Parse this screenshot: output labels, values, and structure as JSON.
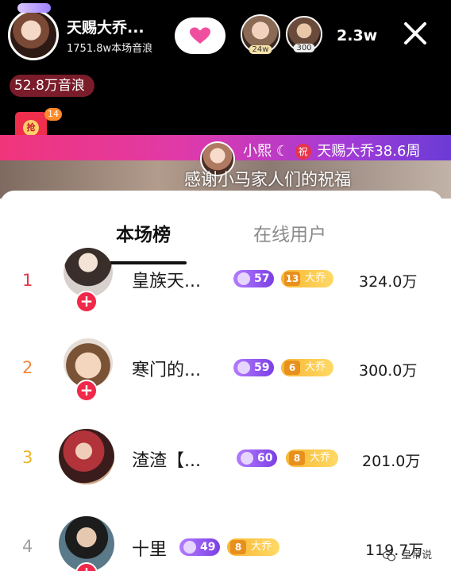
{
  "header": {
    "anchor_name": "天赐大乔...",
    "anchor_stats": "1751.8w本场音浪",
    "viewer_1_tag": "24w",
    "viewer_2_tag": "300",
    "viewer_count": "2.3w",
    "sound_wave": "52.8万音浪",
    "red_packet_label": "抢",
    "red_packet_count": "14",
    "banner_user": "小熙",
    "banner_wish": "祝",
    "banner_target": "天赐大乔38.6周",
    "thanks_message": "感谢小马家人们的祝福"
  },
  "tabs": [
    {
      "label": "本场榜",
      "active": true
    },
    {
      "label": "在线用户",
      "active": false
    }
  ],
  "ranking": [
    {
      "rank": "1",
      "name": "皇族天...",
      "level": "57",
      "fan_level": "13",
      "fan_label": "大乔",
      "score": "324.0万"
    },
    {
      "rank": "2",
      "name": "寒门的...",
      "level": "59",
      "fan_level": "6",
      "fan_label": "大乔",
      "score": "300.0万"
    },
    {
      "rank": "3",
      "name": "渣渣【...",
      "level": "60",
      "fan_level": "8",
      "fan_label": "大乔",
      "score": "201.0万"
    },
    {
      "rank": "4",
      "name": "十里",
      "level": "49",
      "fan_level": "8",
      "fan_label": "大乔",
      "score": "119.7万"
    }
  ],
  "watermark": "皇帝说",
  "colors": {
    "rank_1": "#e0394a",
    "rank_2": "#f0873a",
    "rank_3": "#e8b528",
    "rank_other": "#a0a0a0",
    "accent_red": "#f0284a"
  }
}
